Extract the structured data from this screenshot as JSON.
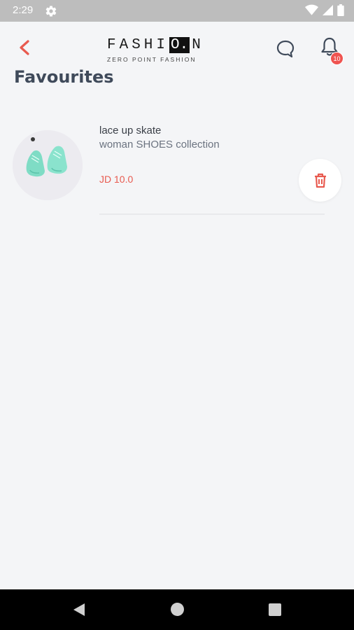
{
  "status_bar": {
    "time": "2:29"
  },
  "header": {
    "logo_text_a": "FASHI",
    "logo_text_box": "O.",
    "logo_text_b": "N",
    "logo_subtitle": "ZERO POINT FASHION",
    "notification_count": "10"
  },
  "page": {
    "title": "Favourites"
  },
  "favourites": [
    {
      "name": "lace up skate",
      "collection": "woman SHOES collection",
      "price": "JD 10.0"
    }
  ],
  "colors": {
    "accent": "#e85a4f",
    "title": "#3f4a5a",
    "background": "#f4f5f7",
    "badge": "#ef5350"
  }
}
